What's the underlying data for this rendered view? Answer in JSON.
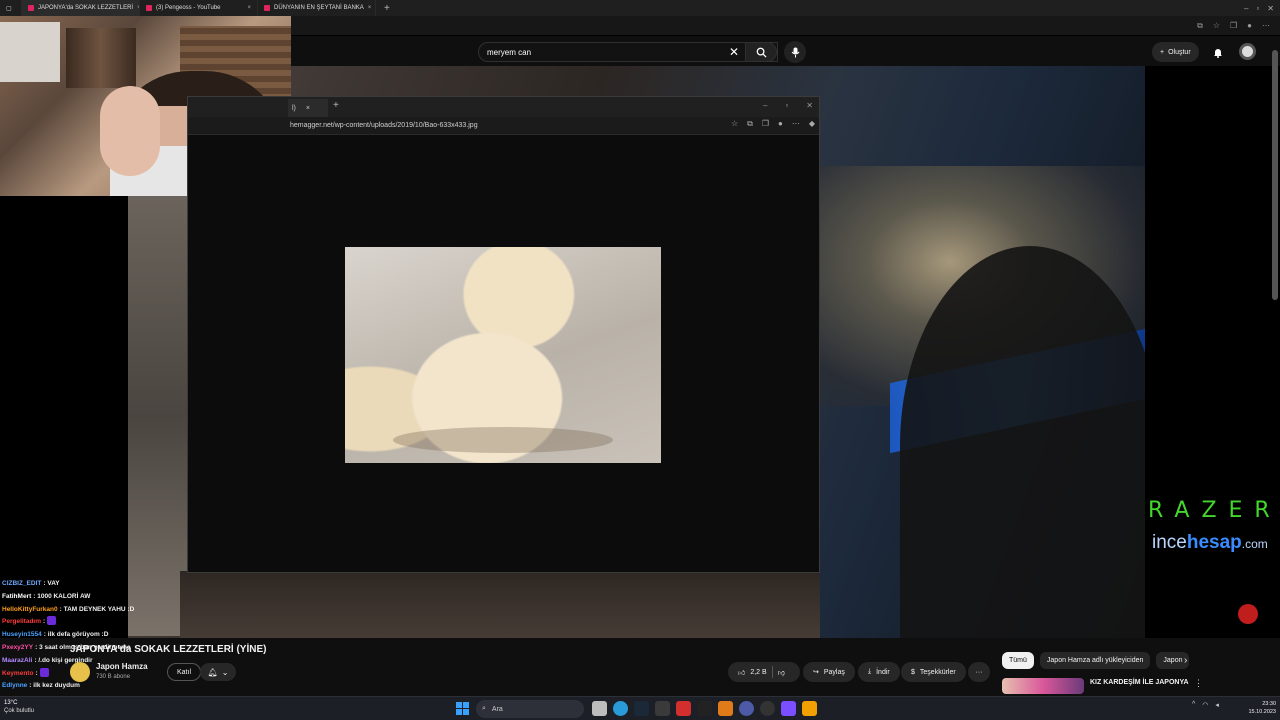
{
  "browser": {
    "tabs": [
      {
        "label": "JAPONYA'da SOKAK LEZZETLERİ",
        "close": "×"
      },
      {
        "label": "(3) Pengeoss - YouTube",
        "close": "×"
      },
      {
        "label": "DÜNYANIN EN ŞEYTANİ BANKA",
        "close": "×"
      }
    ],
    "new_tab": "+"
  },
  "youtube": {
    "search": {
      "value": "meryem can",
      "clear": "✕"
    },
    "create_label": "Oluştur"
  },
  "viewer": {
    "tab_label": "l)",
    "tab_close": "×",
    "new_tab": "+",
    "url": "hemagger.net/wp-content/uploads/2019/10/Bao-633x433.jpg",
    "window_buttons": [
      "–",
      "▫",
      "✕"
    ]
  },
  "overlay": {
    "razer": "RAZER",
    "incehesap_a": "ince",
    "incehesap_b": "hesap",
    "incehesap_c": ".com"
  },
  "chat": [
    {
      "user": "CIZBIZ_EDIT",
      "color": "#6fa8ff",
      "msg": ": VAY",
      "emote": false
    },
    {
      "user": "FatihMert",
      "color": "#ffffff",
      "msg": ": 1000 KALORİ AW",
      "emote": false
    },
    {
      "user": "HelloKittyFurkan0",
      "color": "#ff9f1c",
      "msg": ": TAM DEYNEK YAHU :D",
      "emote": false
    },
    {
      "user": "Pergelitadım",
      "color": "#ff3b3b",
      "msg": ":",
      "emote": true
    },
    {
      "user": "Huseyin1554",
      "color": "#4aa3ff",
      "msg": ": ilk defa görüyom :D",
      "emote": false
    },
    {
      "user": "Pxexy2YY",
      "color": "#ff4da6",
      "msg": ": 3 saat olmuş ban yerdirmeme",
      "emote": false
    },
    {
      "user": "MaarazAli",
      "color": "#b388ff",
      "msg": ": /.do kişi gergindir",
      "emote": false
    },
    {
      "user": "Keymento",
      "color": "#ff3b3b",
      "msg": ":",
      "emote": true
    },
    {
      "user": "Edlynne",
      "color": "#4aa3ff",
      "msg": ": ilk kez duydum",
      "emote": false
    }
  ],
  "video": {
    "title": "JAPONYA'da SOKAK LEZZETLERİ (YİNE)",
    "channel": "Japon Hamza",
    "subscribers": "730 B abone",
    "join_label": "Katıl",
    "likes": "2,2 B",
    "share_label": "Paylaş",
    "download_label": "İndir",
    "thanks_label": "Teşekkürler",
    "more_label": "···"
  },
  "sidebar": {
    "chips": [
      "Tümü",
      "Japon Hamza adlı yükleyiciden",
      "Japon"
    ],
    "rec_title": "KIZ KARDEŞİM İLE JAPONYA",
    "rec_menu": "⋮"
  },
  "taskbar": {
    "weather_temp": "13°C",
    "weather_desc": "Çok bulutlu",
    "search_placeholder": "Ara",
    "time": "23:30",
    "date": "15.10.2023"
  }
}
